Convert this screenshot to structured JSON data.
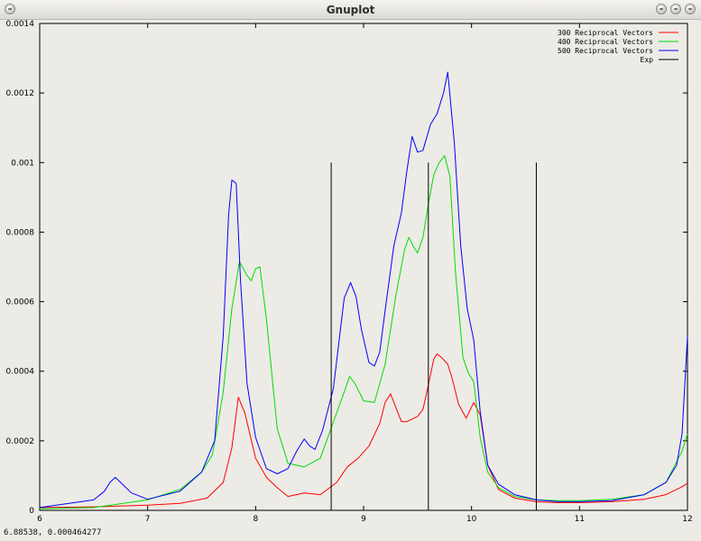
{
  "window": {
    "title": "Gnuplot",
    "status": "6.88538,  0.000464277"
  },
  "colors": {
    "background": "#edebe6",
    "red": "#ff0000",
    "green": "#00dd00",
    "blue": "#0000ff",
    "black": "#000000"
  },
  "chart_data": {
    "type": "line",
    "title": "",
    "xlabel": "",
    "ylabel": "",
    "xlim": [
      6,
      12
    ],
    "ylim": [
      0,
      0.0014
    ],
    "grid": false,
    "legend_position": "top-right",
    "xticks": [
      "6",
      "7",
      "8",
      "9",
      "10",
      "11",
      "12"
    ],
    "yticks": [
      "0",
      "0.0002",
      "0.0004",
      "0.0006",
      "0.0008",
      "0.001",
      "0.0012",
      "0.0014"
    ],
    "series": [
      {
        "name": "300 Reciprocal Vectors",
        "color": "#ff0000",
        "x": [
          6.0,
          6.5,
          7.0,
          7.3,
          7.55,
          7.7,
          7.78,
          7.84,
          7.9,
          8.0,
          8.1,
          8.2,
          8.3,
          8.45,
          8.6,
          8.75,
          8.85,
          8.95,
          9.05,
          9.15,
          9.2,
          9.25,
          9.3,
          9.35,
          9.4,
          9.5,
          9.55,
          9.6,
          9.65,
          9.68,
          9.72,
          9.78,
          9.82,
          9.88,
          9.95,
          10.02,
          10.08,
          10.15,
          10.25,
          10.4,
          10.6,
          10.8,
          11.0,
          11.3,
          11.6,
          11.8,
          11.95,
          12.0
        ],
        "y": [
          8e-06,
          1e-05,
          1.5e-05,
          2e-05,
          3.5e-05,
          8e-05,
          0.00018,
          0.000325,
          0.00028,
          0.00015,
          9.5e-05,
          6.5e-05,
          4e-05,
          5e-05,
          4.5e-05,
          8e-05,
          0.000125,
          0.00015,
          0.000185,
          0.00025,
          0.00031,
          0.000335,
          0.000295,
          0.000255,
          0.000255,
          0.00027,
          0.00029,
          0.00036,
          0.000435,
          0.00045,
          0.00044,
          0.00042,
          0.00038,
          0.000305,
          0.000265,
          0.00031,
          0.000275,
          0.00013,
          6e-05,
          3.5e-05,
          2.5e-05,
          2.2e-05,
          2.2e-05,
          2.5e-05,
          3.2e-05,
          4.5e-05,
          6.8e-05,
          7.8e-05
        ]
      },
      {
        "name": "400 Reciprocal Vectors",
        "color": "#00dd00",
        "x": [
          6.0,
          6.5,
          7.0,
          7.3,
          7.5,
          7.6,
          7.7,
          7.78,
          7.85,
          7.92,
          7.96,
          8.0,
          8.04,
          8.1,
          8.2,
          8.3,
          8.45,
          8.6,
          8.75,
          8.82,
          8.87,
          8.92,
          9.0,
          9.1,
          9.2,
          9.3,
          9.38,
          9.42,
          9.46,
          9.5,
          9.55,
          9.6,
          9.65,
          9.7,
          9.75,
          9.8,
          9.85,
          9.92,
          9.97,
          10.02,
          10.08,
          10.15,
          10.25,
          10.4,
          10.6,
          10.8,
          11.0,
          11.3,
          11.6,
          11.8,
          11.95,
          12.0
        ],
        "y": [
          5e-06,
          8e-06,
          3e-05,
          6e-05,
          0.00011,
          0.00016,
          0.00034,
          0.00058,
          0.000715,
          0.000675,
          0.00066,
          0.000695,
          0.0007,
          0.00055,
          0.000235,
          0.000135,
          0.000125,
          0.00015,
          0.00028,
          0.00034,
          0.000385,
          0.000365,
          0.000315,
          0.00031,
          0.00042,
          0.00062,
          0.00075,
          0.000785,
          0.00076,
          0.00074,
          0.000785,
          0.00088,
          0.000965,
          0.001,
          0.00102,
          0.00096,
          0.00069,
          0.00044,
          0.000395,
          0.00037,
          0.00021,
          0.00011,
          6.5e-05,
          4e-05,
          3e-05,
          2.8e-05,
          2.8e-05,
          3.2e-05,
          4.5e-05,
          8e-05,
          0.00017,
          0.00022
        ]
      },
      {
        "name": "500 Reciprocal Vectors",
        "color": "#0000ff",
        "x": [
          6.0,
          6.5,
          6.6,
          6.65,
          6.7,
          6.75,
          6.85,
          7.0,
          7.3,
          7.5,
          7.62,
          7.7,
          7.75,
          7.78,
          7.82,
          7.86,
          7.92,
          8.0,
          8.1,
          8.2,
          8.3,
          8.38,
          8.45,
          8.5,
          8.55,
          8.62,
          8.72,
          8.82,
          8.88,
          8.93,
          8.98,
          9.05,
          9.1,
          9.15,
          9.2,
          9.28,
          9.35,
          9.4,
          9.45,
          9.5,
          9.55,
          9.62,
          9.68,
          9.74,
          9.78,
          9.84,
          9.9,
          9.96,
          10.02,
          10.08,
          10.15,
          10.25,
          10.4,
          10.6,
          10.8,
          11.0,
          11.3,
          11.6,
          11.8,
          11.9,
          11.95,
          12.0
        ],
        "y": [
          8e-06,
          3e-05,
          5.5e-05,
          8e-05,
          9.5e-05,
          8e-05,
          5e-05,
          3.2e-05,
          5.5e-05,
          0.00011,
          0.0002,
          0.0005,
          0.00085,
          0.00095,
          0.00094,
          0.00066,
          0.000365,
          0.00021,
          0.00012,
          0.000105,
          0.00012,
          0.00017,
          0.000205,
          0.000185,
          0.000175,
          0.00023,
          0.00035,
          0.00061,
          0.000655,
          0.000615,
          0.00052,
          0.000425,
          0.000415,
          0.000455,
          0.000575,
          0.00076,
          0.000855,
          0.000975,
          0.001075,
          0.00103,
          0.001035,
          0.00111,
          0.00114,
          0.0012,
          0.00126,
          0.00106,
          0.00076,
          0.00058,
          0.00049,
          0.000285,
          0.00013,
          7.5e-05,
          4.5e-05,
          3e-05,
          2.5e-05,
          2.5e-05,
          2.8e-05,
          4.5e-05,
          8e-05,
          0.00013,
          0.00022,
          0.0005
        ]
      },
      {
        "name": "Exp",
        "color": "#000000",
        "type": "impulses",
        "x": [
          8.7,
          9.6,
          10.6
        ],
        "y": [
          0.001,
          0.001,
          0.001
        ]
      }
    ]
  }
}
